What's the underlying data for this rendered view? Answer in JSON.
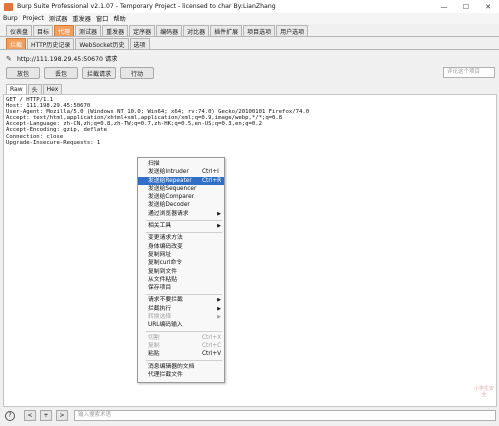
{
  "window": {
    "title": "Burp Suite Professional v2.1.07 - Temporary Project - licensed to char By:LianZhang",
    "controls": [
      "—",
      "☐",
      "✕"
    ]
  },
  "menubar": [
    "Burp",
    "Project",
    "测试器",
    "重发器",
    "窗口",
    "帮助"
  ],
  "main_tabs": [
    {
      "label": "仪表盘"
    },
    {
      "label": "目标"
    },
    {
      "label": "代理",
      "active": true
    },
    {
      "label": "测试器"
    },
    {
      "label": "重发器"
    },
    {
      "label": "定序器"
    },
    {
      "label": "编码器"
    },
    {
      "label": "对比器"
    },
    {
      "label": "插件扩展"
    },
    {
      "label": "项目选项"
    },
    {
      "label": "用户选项"
    }
  ],
  "sub_tabs": [
    {
      "label": "拦截",
      "active": true
    },
    {
      "label": "HTTP历史记录"
    },
    {
      "label": "WebSocket历史"
    },
    {
      "label": "选项"
    }
  ],
  "request": {
    "url_line": "http://111.198.29.45:50670 请求"
  },
  "toolbar": {
    "forward": "放包",
    "drop": "丢包",
    "intercept": "拦截请求",
    "action": "行动",
    "comment_placeholder": "评论这个项目"
  },
  "view_tabs": [
    {
      "label": "Raw",
      "active": true
    },
    {
      "label": "头"
    },
    {
      "label": "Hex"
    }
  ],
  "raw_request": [
    "GET / HTTP/1.1",
    "Host: 111.198.29.45:50670",
    "User-Agent: Mozilla/5.0 (Windows NT 10.0; Win64; x64; rv:74.0) Gecko/20100101 Firefox/74.0",
    "Accept: text/html,application/xhtml+xml,application/xml;q=0.9,image/webp,*/*;q=0.8",
    "Accept-Language: zh-CN,zh;q=0.8,zh-TW;q=0.7,zh-HK;q=0.5,en-US;q=0.3,en;q=0.2",
    "Accept-Encoding: gzip, deflate",
    "Connection: close",
    "Upgrade-Insecure-Requests: 1"
  ],
  "context_menu": {
    "groups": [
      [
        {
          "label": "扫描"
        },
        {
          "label": "发送给Intruder",
          "shortcut": "Ctrl+I"
        },
        {
          "label": "发送给Repeater",
          "shortcut": "Ctrl+R",
          "highlighted": true
        },
        {
          "label": "发送给Sequencer"
        },
        {
          "label": "发送给Comparer"
        },
        {
          "label": "发送给Decoder"
        },
        {
          "label": "通过浏览器请求",
          "submenu": true
        }
      ],
      [
        {
          "label": "相关工具",
          "submenu": true
        }
      ],
      [
        {
          "label": "变更请求方法"
        },
        {
          "label": "身体编码改变"
        },
        {
          "label": "复制网址"
        },
        {
          "label": "复制curl命令"
        },
        {
          "label": "复制到文件"
        },
        {
          "label": "从文件粘贴"
        },
        {
          "label": "保存项目"
        }
      ],
      [
        {
          "label": "请求不要拦截",
          "submenu": true
        },
        {
          "label": "拦截执行",
          "submenu": true
        },
        {
          "label": "转换选择",
          "submenu": true,
          "disabled": true
        },
        {
          "label": "URL编码输入"
        }
      ],
      [
        {
          "label": "切割",
          "shortcut": "Ctrl+X",
          "disabled": true
        },
        {
          "label": "复制",
          "shortcut": "Ctrl+C",
          "disabled": true
        },
        {
          "label": "粘贴",
          "shortcut": "Ctrl+V"
        }
      ],
      [
        {
          "label": "消息编辑器的文档"
        },
        {
          "label": "代理拦截文件"
        }
      ]
    ]
  },
  "bottom": {
    "help": "?",
    "nav": [
      "<",
      "+",
      ">"
    ],
    "search_placeholder": "输入搜索术语"
  },
  "watermark": "小学生安全"
}
